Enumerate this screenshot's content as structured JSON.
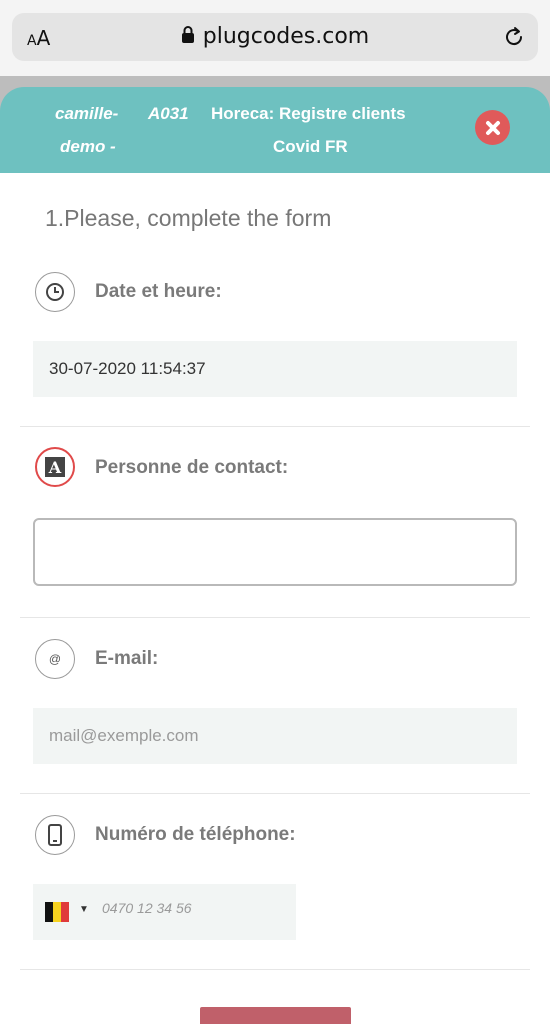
{
  "browser": {
    "text_size_label": "AA",
    "url": "plugcodes.com"
  },
  "header": {
    "user_line1": "camille-",
    "user_line2": "demo -",
    "code": "A031",
    "title_line1": "Horeca: Registre clients",
    "title_line2": "Covid FR"
  },
  "form": {
    "title": "1.Please, complete the form",
    "fields": [
      {
        "label": "Date et heure:",
        "value": "30-07-2020 11:54:37",
        "icon": "clock-icon"
      },
      {
        "label": "Personne de contact:",
        "value": "",
        "icon": "text-a-icon"
      },
      {
        "label": "E-mail:",
        "placeholder": "mail@exemple.com",
        "icon": "at-icon"
      },
      {
        "label": "Numéro de téléphone:",
        "placeholder": "0470 12 34 56",
        "icon": "phone-icon"
      }
    ],
    "country_flag": "BE"
  },
  "colors": {
    "header_bg": "#6ec1c0",
    "close_button": "#e05a5a",
    "submit_button": "#c0606a",
    "active_icon_border": "#e04a4a"
  }
}
